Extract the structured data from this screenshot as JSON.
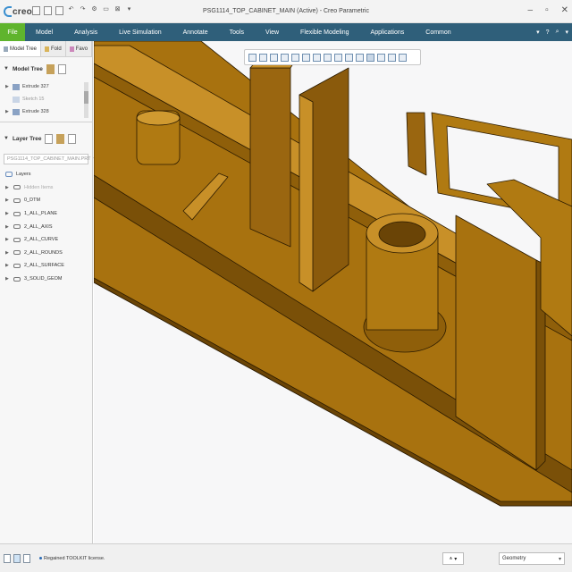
{
  "app": {
    "logo_text": "creo",
    "window_title": "PSG1114_TOP_CABINET_MAIN (Active) - Creo Parametric"
  },
  "quick_access": [
    "new-icon",
    "open-icon",
    "save-icon",
    "undo-icon",
    "redo-icon",
    "regenerate-icon",
    "windows-icon",
    "close-icon",
    "customize-icon"
  ],
  "menu": {
    "items": [
      "File",
      "Model",
      "Analysis",
      "Live Simulation",
      "Annotate",
      "Tools",
      "View",
      "Flexible Modeling",
      "Applications",
      "Common"
    ],
    "active_color": "#5fb42d",
    "bar_color": "#2f5f7a"
  },
  "panel": {
    "tabs": [
      "Model Tree",
      "Fold",
      "Favo"
    ],
    "model_tree": {
      "title": "Model Tree",
      "items": [
        {
          "label": "Extrude 327",
          "dim": false
        },
        {
          "label": "Sketch 15",
          "dim": true
        },
        {
          "label": "Extrude 328",
          "dim": false
        }
      ]
    },
    "layer_tree": {
      "title": "Layer Tree",
      "model_combo": "PSG1114_TOP_CABINET_MAIN.PRT",
      "root": "Layers",
      "items": [
        {
          "label": "Hidden Items",
          "dim": true
        },
        {
          "label": "0_DTM",
          "dim": false
        },
        {
          "label": "1_ALL_PLANE",
          "dim": false
        },
        {
          "label": "2_ALL_AXIS",
          "dim": false
        },
        {
          "label": "2_ALL_CURVE",
          "dim": false
        },
        {
          "label": "2_ALL_ROUNDS",
          "dim": false
        },
        {
          "label": "2_ALL_SURFACE",
          "dim": false
        },
        {
          "label": "3_SOLID_GEOM",
          "dim": false
        }
      ]
    }
  },
  "model_colors": {
    "face": "#a8720f",
    "dark": "#7a5008",
    "light": "#c89028",
    "edge": "#2a1a00"
  },
  "status": {
    "message": "Regained TOOLKIT license.",
    "filter_value": "Geometry"
  }
}
